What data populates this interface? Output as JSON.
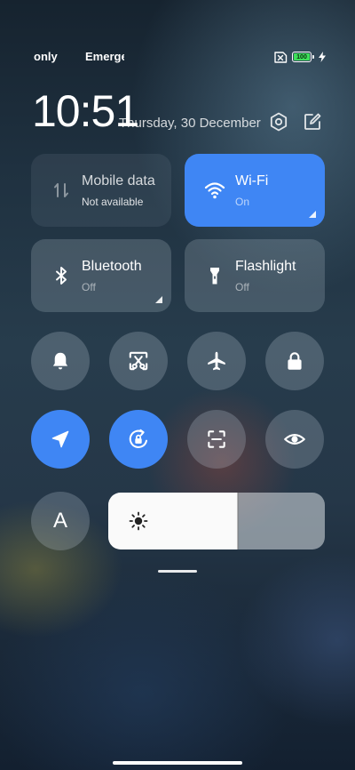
{
  "status_bar": {
    "left_text_1": "only",
    "left_text_2": "Emergency calls",
    "sim_icon": "sim-no-service-icon",
    "battery_level": "100",
    "battery_color": "#3ee05a",
    "charging_icon": "bolt-icon"
  },
  "header": {
    "time": "10:51",
    "date": "Thursday, 30 December",
    "settings_icon": "settings-hexagon-icon",
    "edit_icon": "edit-icon"
  },
  "tiles": [
    {
      "title": "Mobile data",
      "subtitle": "Not available",
      "state": "disabled",
      "icon": "mobile-data-icon"
    },
    {
      "title": "Wi-Fi",
      "subtitle": "On",
      "state": "active",
      "icon": "wifi-icon"
    },
    {
      "title": "Bluetooth",
      "subtitle": "Off",
      "state": "inactive",
      "icon": "bluetooth-icon"
    },
    {
      "title": "Flashlight",
      "subtitle": "Off",
      "state": "inactive",
      "icon": "flashlight-icon"
    }
  ],
  "toggles": [
    {
      "icon": "bell-icon",
      "state": "inactive"
    },
    {
      "icon": "screenshot-icon",
      "state": "inactive"
    },
    {
      "icon": "airplane-icon",
      "state": "inactive"
    },
    {
      "icon": "lock-icon",
      "state": "inactive"
    },
    {
      "icon": "location-icon",
      "state": "active"
    },
    {
      "icon": "auto-rotate-lock-icon",
      "state": "active"
    },
    {
      "icon": "scanner-icon",
      "state": "inactive"
    },
    {
      "icon": "eye-icon",
      "state": "inactive"
    }
  ],
  "font_toggle": {
    "label": "A"
  },
  "brightness": {
    "level": 0.6,
    "icon": "sun-icon"
  },
  "colors": {
    "accent": "#3f86f4"
  }
}
